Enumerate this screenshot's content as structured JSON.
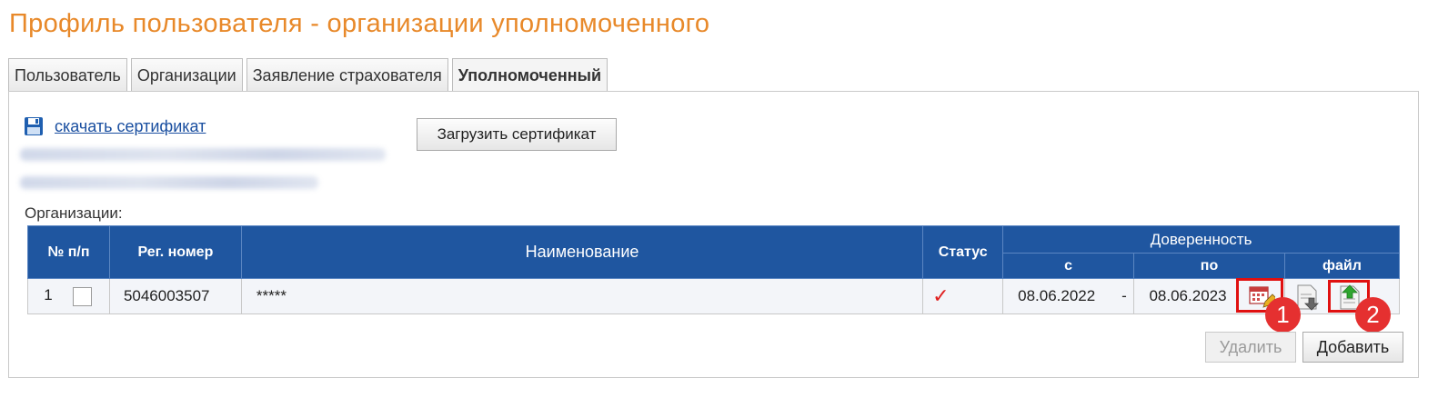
{
  "page": {
    "title": "Профиль пользователя - организации уполномоченного"
  },
  "tabs": [
    {
      "label": "Пользователь"
    },
    {
      "label": "Организации"
    },
    {
      "label": "Заявление страхователя"
    },
    {
      "label": "Уполномоченный",
      "active": true
    }
  ],
  "certificate": {
    "download_label": "скачать сертификат",
    "upload_label": "Загрузить сертификат"
  },
  "organizations": {
    "label": "Организации:",
    "headers": {
      "num": "№ п/п",
      "reg": "Рег. номер",
      "name": "Наименование",
      "status": "Статус",
      "proxy": "Доверенность",
      "from": "с",
      "to": "по",
      "file": "файл"
    },
    "rows": [
      {
        "num": "1",
        "reg": "5046003507",
        "name": "*****",
        "status": "✓",
        "from": "08.06.2022",
        "dash": "-",
        "to": "08.06.2023"
      }
    ]
  },
  "annotations": {
    "one": "1",
    "two": "2"
  },
  "actions": {
    "delete_label": "Удалить",
    "add_label": "Добавить"
  },
  "colors": {
    "accent": "#e8892a",
    "header": "#1f56a0",
    "highlight": "#e01010"
  }
}
